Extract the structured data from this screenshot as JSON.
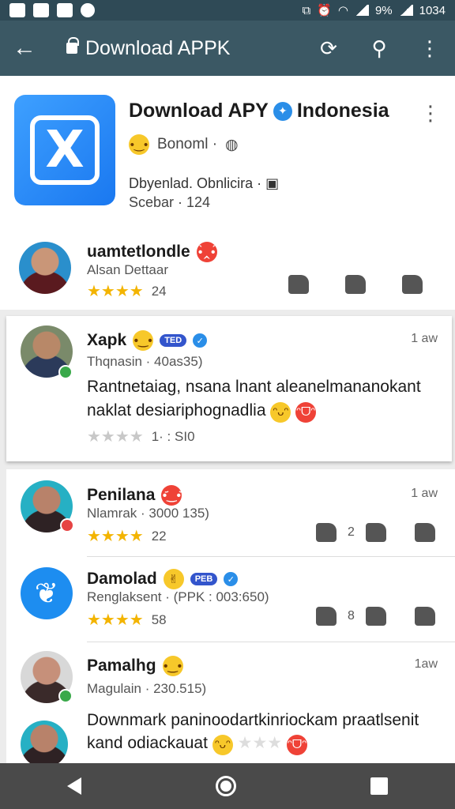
{
  "status": {
    "time": "1034",
    "battery": "9%"
  },
  "appbar": {
    "title": "Download APPK"
  },
  "app": {
    "name_a": "Download APY",
    "name_b": "Indonesia",
    "sub": "Bonoml ·",
    "meta1": "Dbyenlad. Obnlicira ·",
    "meta2": "Scebar · 124"
  },
  "reviews": [
    {
      "name": "uamtetlondle",
      "sub": "Alsan Dettaar",
      "count": "24"
    },
    {
      "name": "Xapk",
      "tag": "TED",
      "sub": "Thqnasin · 40as35)",
      "time": "1 aw",
      "line1": "Rantnetaiag, nsana lnant aleanelmananokant",
      "line2": "naklat desiariphognadlia",
      "count": "1· : SI0"
    },
    {
      "name": "Penilana",
      "sub": "Nlamrak · 3000 135)",
      "time": "1 aw",
      "count": "22",
      "like": "2"
    },
    {
      "name": "Damolad",
      "tag": "PEB",
      "sub": "Renglaksent · (PPK : 003:650)",
      "count": "58",
      "like": "8"
    },
    {
      "name": "Pamalhg",
      "sub": "Magulain · 230.515)",
      "time": "1aw",
      "line1": "Downmark paninoodartkinriockam praatlsenit",
      "line2": "kand odiackauat"
    }
  ],
  "colors": {
    "appbar": "#3b5864",
    "star": "#f3b400",
    "accent": "#2a8ee8"
  }
}
